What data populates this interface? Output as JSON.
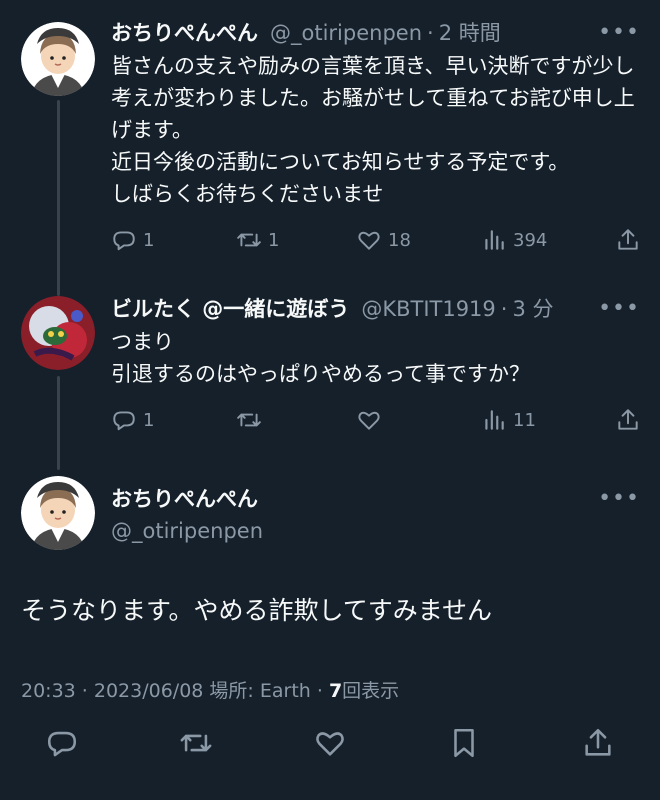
{
  "tweets": [
    {
      "name": "おちりぺんぺん",
      "handle": "@_otiripenpen",
      "time": "2 時間",
      "text": "皆さんの支えや励みの言葉を頂き、早い決断ですが少し考えが変わりました。お騒がせして重ねてお詫び申し上げます。\n近日今後の活動についてお知らせする予定です。\nしばらくお待ちくださいませ",
      "replies": "1",
      "retweets": "1",
      "likes": "18",
      "views": "394"
    },
    {
      "name": "ビルたく @一緒に遊ぼう",
      "handle": "@KBTIT1919",
      "time": "3 分",
      "text": "つまり\n引退するのはやっぱりやめるって事ですか？",
      "replies": "1",
      "retweets": "",
      "likes": "",
      "views": "11"
    }
  ],
  "main": {
    "name": "おちりぺんぺん",
    "handle": "@_otiripenpen",
    "text": "そうなります。やめる詐欺してすみません",
    "timestamp": "20:33 · 2023/06/08 場所: Earth · ",
    "view_count": "7",
    "view_label": "回表示"
  },
  "icons": {
    "reply": "reply-icon",
    "retweet": "retweet-icon",
    "like": "heart-icon",
    "views": "views-icon",
    "share": "share-icon",
    "bookmark": "bookmark-icon",
    "more": "more-icon"
  },
  "colors": {
    "background": "#15202b",
    "text": "#f7f9f9",
    "secondary": "#8b98a5",
    "thread_line": "#38444d"
  }
}
